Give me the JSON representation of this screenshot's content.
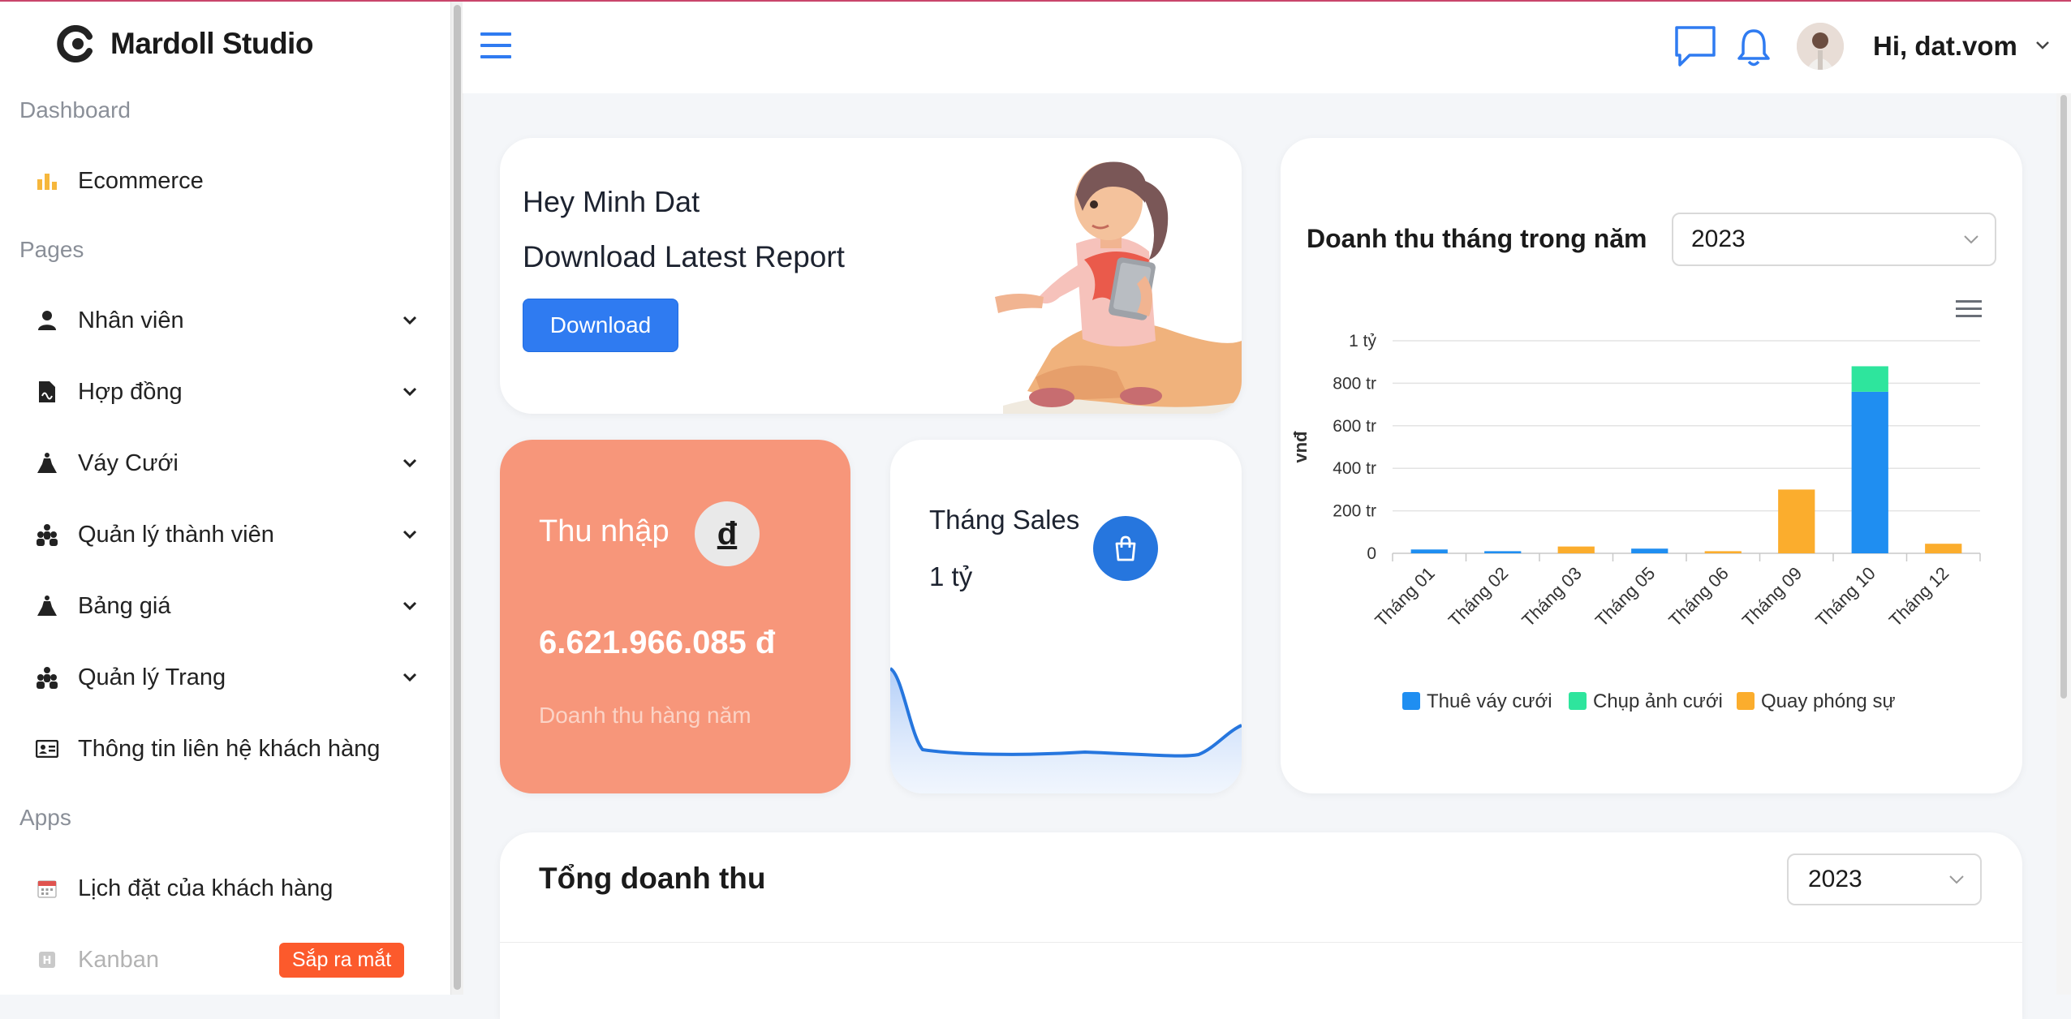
{
  "brand": {
    "name": "Mardoll Studio"
  },
  "sidebar": {
    "sections": {
      "dashboard": "Dashboard",
      "pages": "Pages",
      "apps": "Apps"
    },
    "items": [
      {
        "label": "Ecommerce",
        "icon": "bar-chart-icon"
      },
      {
        "label": "Nhân viên",
        "icon": "user-icon"
      },
      {
        "label": "Hợp đồng",
        "icon": "contract-icon"
      },
      {
        "label": "Váy Cưới",
        "icon": "dress-icon"
      },
      {
        "label": "Quản lý thành viên",
        "icon": "users-icon"
      },
      {
        "label": "Bảng giá",
        "icon": "price-icon"
      },
      {
        "label": "Quản lý Trang",
        "icon": "users-icon"
      },
      {
        "label": "Thông tin liên hệ khách hàng",
        "icon": "contact-card-icon"
      },
      {
        "label": "Lịch đặt của khách hàng",
        "icon": "calendar-icon"
      },
      {
        "label": "Kanban",
        "icon": "kanban-icon",
        "badge": "Sắp ra mắt"
      }
    ]
  },
  "header": {
    "greeting": "Hi, dat.vom"
  },
  "welcome": {
    "line1": "Hey Minh Dat",
    "line2": "Download Latest Report",
    "button": "Download"
  },
  "income": {
    "title": "Thu nhập",
    "icon_symbol": "đ",
    "value": "6.621.966.085 đ",
    "subtitle": "Doanh thu hàng năm"
  },
  "sales": {
    "title": "Tháng Sales",
    "value": "1 tỷ"
  },
  "revenue": {
    "title": "Doanh thu tháng trong năm",
    "year": "2023"
  },
  "total": {
    "title": "Tổng doanh thu",
    "year": "2023"
  },
  "colors": {
    "accent": "#2f7bf1",
    "income_card": "#f7967a",
    "series_rent": "#1f8ef1",
    "series_photo": "#2ee59d",
    "series_video": "#fbad2d",
    "soon_badge": "#fc5a2c"
  },
  "chart_data": {
    "type": "bar",
    "stacked": true,
    "title": "",
    "ylabel": "vnđ",
    "y_tick_labels": [
      "0",
      "200 tr",
      "400 tr",
      "600 tr",
      "800 tr",
      "1 tỷ"
    ],
    "ylim": [
      0,
      1000
    ],
    "y_unit": "triệu đồng",
    "categories": [
      "Tháng 01",
      "Tháng 02",
      "Tháng 03",
      "Tháng 05",
      "Tháng 06",
      "Tháng 09",
      "Tháng 10",
      "Tháng 12"
    ],
    "series": [
      {
        "name": "Thuê váy cưới",
        "values": [
          18,
          10,
          0,
          22,
          0,
          0,
          760,
          0
        ]
      },
      {
        "name": "Chụp ảnh cưới",
        "values": [
          0,
          0,
          0,
          0,
          0,
          0,
          120,
          0
        ]
      },
      {
        "name": "Quay phóng sự",
        "values": [
          0,
          0,
          32,
          0,
          10,
          300,
          0,
          45
        ]
      }
    ],
    "legend": "bottom",
    "grid": true
  }
}
